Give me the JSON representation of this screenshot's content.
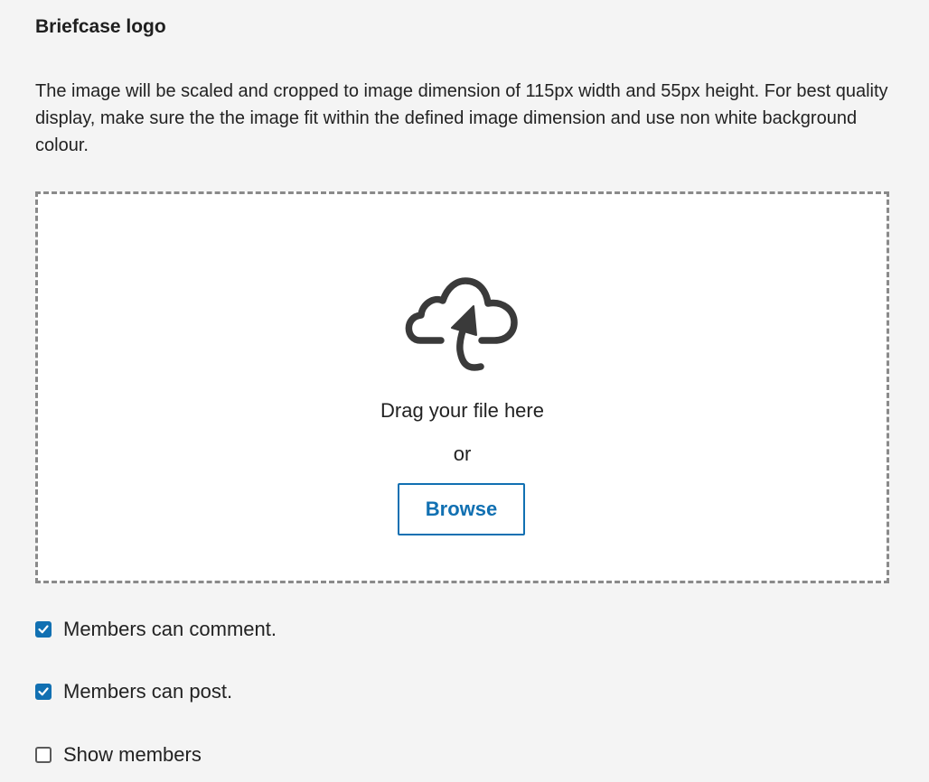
{
  "section": {
    "title": "Briefcase logo",
    "description": "The image will be scaled and cropped to image dimension of 115px width and 55px height. For best quality display, make sure the the image fit within the defined image dimension and use non white background colour."
  },
  "dropzone": {
    "icon": "cloud-upload-icon",
    "drag_text": "Drag your file here",
    "or_text": "or",
    "browse_label": "Browse"
  },
  "options": [
    {
      "label": "Members can comment.",
      "checked": true
    },
    {
      "label": "Members can post.",
      "checked": true
    },
    {
      "label": "Show members",
      "checked": false
    }
  ],
  "colors": {
    "accent": "#1170b2",
    "background": "#f4f4f4",
    "icon": "#3a3a3a",
    "dropzone_border": "#8a8a8a"
  }
}
